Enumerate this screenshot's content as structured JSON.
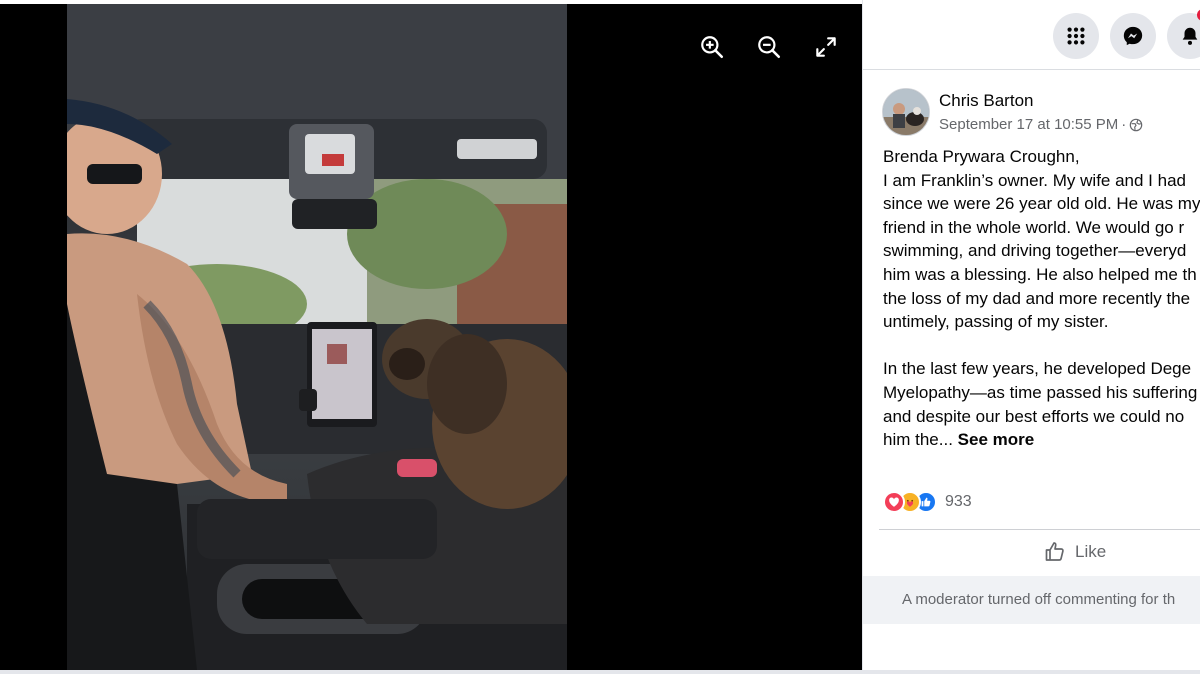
{
  "viewer": {
    "photo_alt": "",
    "controls": [
      {
        "name": "zoom-in-icon"
      },
      {
        "name": "zoom-out-icon"
      },
      {
        "name": "fullscreen-icon"
      }
    ]
  },
  "topbar": {
    "icons": [
      "menu-grid-icon",
      "messenger-icon",
      "bell-icon"
    ]
  },
  "post": {
    "author": "Chris Barton",
    "timestamp": "September 17 at 10:55 PM",
    "separator": "·",
    "audience_icon": "globe-icon",
    "mention": "Brenda Prywara Croughn",
    "mention_suffix": ",",
    "paragraph1": [
      "I am Franklin’s owner. My wife and I had",
      "since we were 26 year old old. He was my",
      "friend in the whole world. We would go r",
      "swimming, and driving together—everyd",
      "him was a blessing. He also helped me th",
      "the loss of my dad and more recently the",
      "untimely, passing of my sister."
    ],
    "paragraph2": [
      "In the last few years, he developed Dege",
      "Myelopathy—as time passed his suffering",
      "and despite our best efforts we could no"
    ],
    "last_line": "him the...",
    "see_more": "See more",
    "reactions": [
      "love",
      "care",
      "like"
    ],
    "reaction_count": "933",
    "like_label": "Like",
    "moderator_notice": "A moderator turned off commenting for th"
  },
  "colors": {
    "love": "#f33e58",
    "care": "#f7b125",
    "like": "#1877f2",
    "notification": "#e41e3f"
  }
}
